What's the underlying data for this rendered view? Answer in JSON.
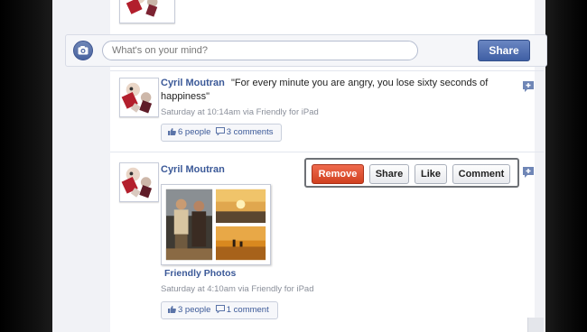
{
  "composer": {
    "placeholder": "What's on your mind?",
    "share_label": "Share"
  },
  "posts": [
    {
      "author": "Cyril Moutran",
      "text": "\"For every minute you are angry, you lose sixty seconds of",
      "text_line2": "happiness\"",
      "meta": "Saturday at 10:14am via Friendly for iPad",
      "likes": "6 people",
      "comments": "3 comments"
    },
    {
      "author": "Cyril Moutran",
      "album": "Friendly Photos",
      "meta": "Saturday at 4:10am via Friendly for iPad",
      "likes": "3 people",
      "comments": "1 comment"
    }
  ],
  "actions": {
    "remove": "Remove",
    "share": "Share",
    "like": "Like",
    "comment": "Comment"
  },
  "colors": {
    "brand": "#3b5998",
    "remove": "#d94a2a"
  },
  "icons": [
    "camera-icon",
    "thumbs-up-icon",
    "comment-icon",
    "add-comment-icon"
  ]
}
